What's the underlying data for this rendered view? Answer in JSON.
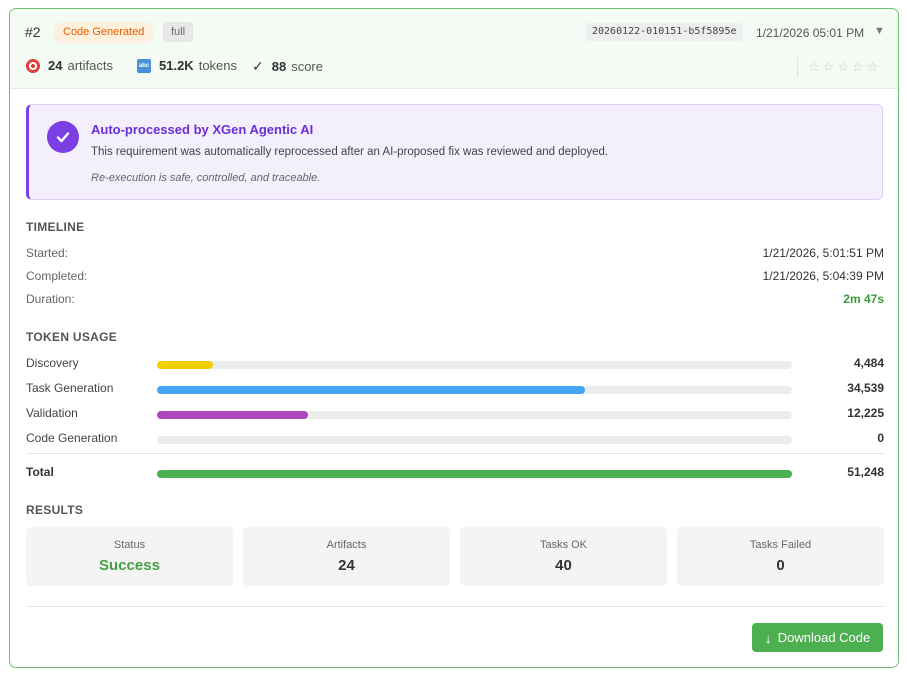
{
  "header": {
    "run_number": "#2",
    "status_badge": "Code Generated",
    "mode": "full",
    "run_id": "20260122-010151-b5f5895e",
    "date": "1/21/2026 05:01 PM",
    "stats": {
      "artifacts_count": "24",
      "artifacts_label": "artifacts",
      "tokens_count": "51.2K",
      "tokens_label": "tokens",
      "score_count": "88",
      "score_label": "score"
    },
    "rating_stars": 0
  },
  "ai_notice": {
    "title": "Auto-processed by XGen Agentic AI",
    "description": "This requirement was automatically reprocessed after an AI-proposed fix was reviewed and deployed.",
    "note": "Re-execution is safe, controlled, and traceable."
  },
  "timeline": {
    "title": "TIMELINE",
    "rows": [
      {
        "label": "Started:",
        "value": "1/21/2026, 5:01:51 PM"
      },
      {
        "label": "Completed:",
        "value": "1/21/2026, 5:04:39 PM"
      },
      {
        "label": "Duration:",
        "value": "2m 47s"
      }
    ]
  },
  "token_usage": {
    "title": "TOKEN USAGE",
    "rows": [
      {
        "label": "Discovery",
        "value": "4,484",
        "color": "#f2cf00",
        "fraction": 0.0875
      },
      {
        "label": "Task Generation",
        "value": "34,539",
        "color": "#42a5f5",
        "fraction": 0.674
      },
      {
        "label": "Validation",
        "value": "12,225",
        "color": "#ab47bc",
        "fraction": 0.2385
      },
      {
        "label": "Code Generation",
        "value": "0",
        "color": "#9e9e9e",
        "fraction": 0
      }
    ],
    "total": {
      "label": "Total",
      "value": "51,248",
      "color": "#4caf50",
      "fraction": 1
    }
  },
  "results": {
    "title": "RESULTS",
    "items": [
      {
        "label": "Status",
        "value": "Success"
      },
      {
        "label": "Artifacts",
        "value": "24"
      },
      {
        "label": "Tasks OK",
        "value": "40"
      },
      {
        "label": "Tasks Failed",
        "value": "0"
      }
    ]
  },
  "footer": {
    "download_label": "Download Code"
  },
  "colors": {
    "border": "#6ebf6e",
    "accent_purple": "#7b3fe4",
    "success_green": "#4caf50"
  }
}
